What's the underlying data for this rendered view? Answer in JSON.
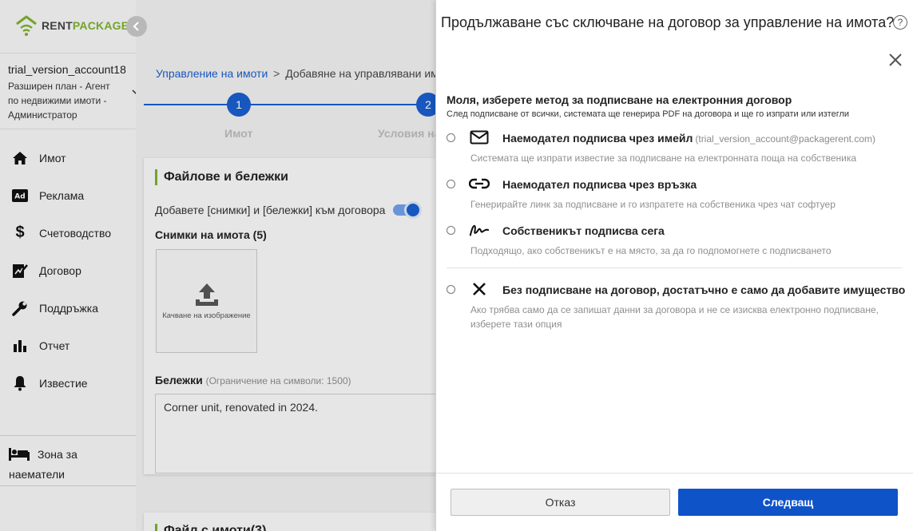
{
  "brand": {
    "rent": "RENT",
    "package": "PACKAGE"
  },
  "sidebar": {
    "collapse_icon": "chevron-left-icon",
    "account": {
      "name": "trial_version_account18",
      "role": "Разширен план - Агент по недвижими имоти - Администратор"
    },
    "items": [
      {
        "label": "Имот",
        "icon": "home-icon"
      },
      {
        "label": "Реклама",
        "icon": "ad-icon"
      },
      {
        "label": "Счетоводство",
        "icon": "dollar-icon"
      },
      {
        "label": "Договор",
        "icon": "contract-icon"
      },
      {
        "label": "Поддръжка",
        "icon": "wrench-icon"
      },
      {
        "label": "Отчет",
        "icon": "bar-chart-icon"
      },
      {
        "label": "Известие",
        "icon": "bell-icon"
      }
    ],
    "tenant_zone": {
      "label": "Зона за наематели",
      "icon": "bed-icon"
    }
  },
  "main": {
    "breadcrumb": {
      "root": "Управление на имоти",
      "separator": ">",
      "current": "Добавяне на управлявани им"
    },
    "steps": [
      {
        "number": "1",
        "label": "Имот"
      },
      {
        "number": "2",
        "label": "Условия на"
      }
    ],
    "files_card": {
      "title": "Файлове и бележки",
      "toggle_label": "Добавете [снимки] и [бележки] към договора",
      "toggle_on": true,
      "photos_label": "Снимки на имота (5)",
      "upload_label": "Качване на изображение",
      "notes_label": "Бележки",
      "notes_limit": "(Ограничение на символи: 1500)",
      "notes_value": "Corner unit, renovated in 2024."
    },
    "second_card_title": "Файл с имоти(3)"
  },
  "drawer": {
    "title": "Продължаване със сключване на договор за управление на имота?",
    "help_icon": "question-circle-icon",
    "close_icon": "close-icon",
    "heading": "Моля, изберете метод за подписване на електронния договор",
    "subheading": "След подписване от всички, системата ще генерира PDF на договора и ще го изпрати или изтегли",
    "options": [
      {
        "icon": "envelope-icon",
        "title": "Наемодател подписва чрез имейл",
        "email": "(trial_version_account@packagerent.com)",
        "description": "Системата ще изпрати известие за подписване на електронната поща на собственика",
        "selected": false
      },
      {
        "icon": "link-icon",
        "title": "Наемодател подписва чрез връзка",
        "description": "Генерирайте линк за подписване и го изпратете на собственика чрез чат софтуер",
        "selected": false
      },
      {
        "icon": "signature-icon",
        "title": "Собственикът подписва сега",
        "description": "Подходящо, ако собственикът е на място, за да го подпомогнете с подписването",
        "selected": false
      },
      {
        "icon": "x-icon",
        "title": "Без подписване на договор, достатъчно е само да добавите имущество",
        "description": "Ако трябва само да се запишат данни за договора и не се изисква електронно подписване,",
        "description2": "изберете тази опция",
        "selected": false
      }
    ],
    "cancel_label": "Отказ",
    "next_label": "Следващ"
  },
  "colors": {
    "primary": "#0f53c9",
    "brand_green": "#7cae2e",
    "link": "#1a5dc9"
  }
}
